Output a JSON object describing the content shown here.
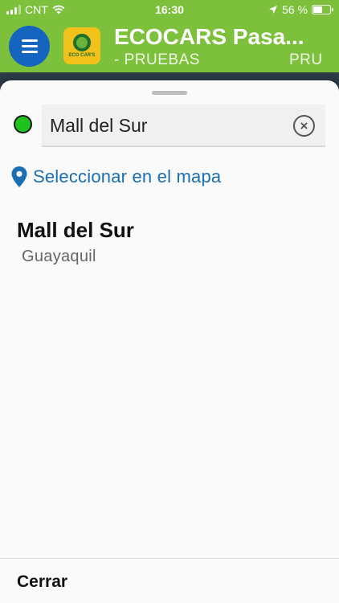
{
  "status_bar": {
    "carrier": "CNT",
    "time": "16:30",
    "battery_percent": "56 %",
    "battery_level": 0.56
  },
  "header": {
    "title": "ECOCARS Pasa...",
    "subtitle": "- PRUEBAS",
    "subtitle_right": "PRU",
    "logo_text": "ECO CAR'S"
  },
  "sheet": {
    "search_value": "Mall del Sur",
    "select_on_map_label": "Seleccionar en el mapa",
    "results": [
      {
        "title": "Mall del Sur",
        "subtitle": "Guayaquil"
      }
    ],
    "close_label": "Cerrar"
  },
  "colors": {
    "header_bg": "#7cc03c",
    "menu_button": "#1565c0",
    "link": "#1a6fb5",
    "origin_dot": "#1ec41e"
  }
}
